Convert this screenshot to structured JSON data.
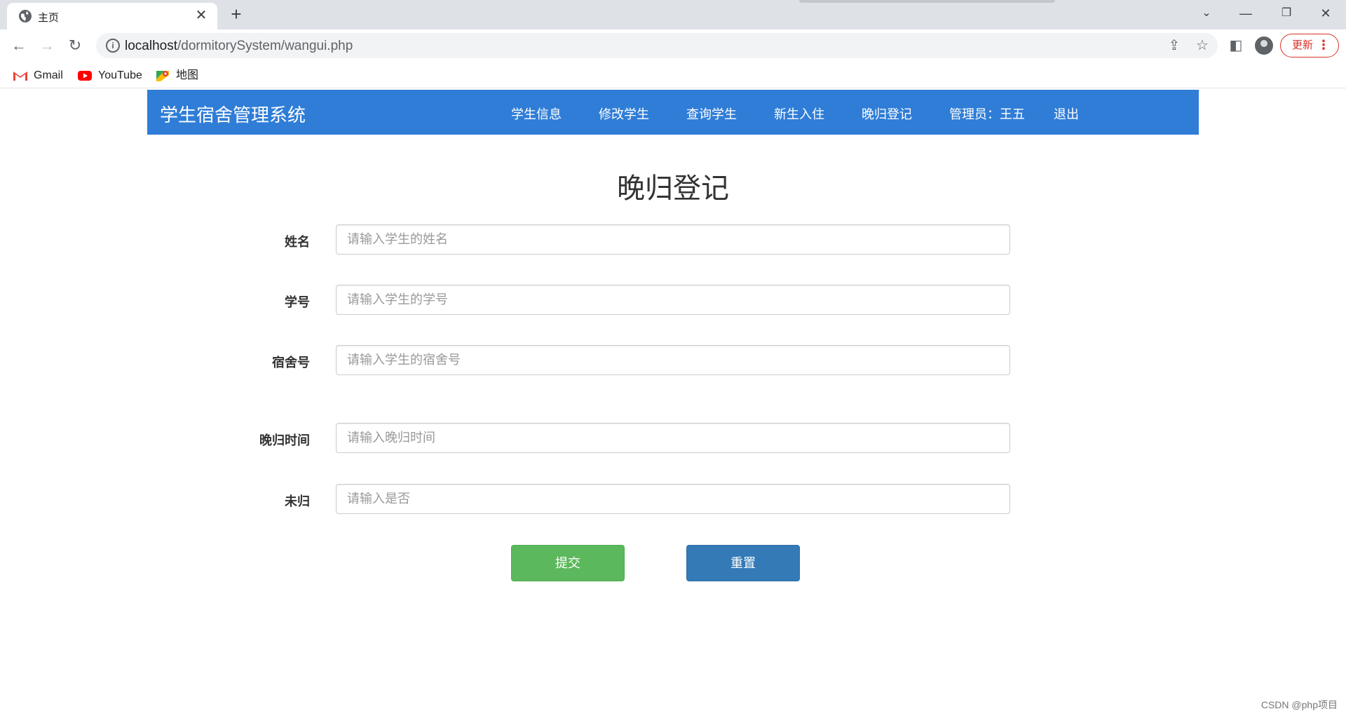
{
  "browser": {
    "tab_title": "主页",
    "url_host": "localhost",
    "url_path": "/dormitorySystem/wangui.php",
    "update_label": "更新",
    "bookmarks": [
      {
        "label": "Gmail",
        "icon": "gmail-icon"
      },
      {
        "label": "YouTube",
        "icon": "youtube-icon"
      },
      {
        "label": "地图",
        "icon": "maps-icon"
      }
    ]
  },
  "navbar": {
    "brand": "学生宿舍管理系统",
    "links": [
      "学生信息",
      "修改学生",
      "查询学生",
      "新生入住",
      "晚归登记",
      "管理员：王五",
      "退出"
    ]
  },
  "page": {
    "title": "晚归登记"
  },
  "form": {
    "fields": [
      {
        "label": "姓名",
        "placeholder": "请输入学生的姓名",
        "value": ""
      },
      {
        "label": "学号",
        "placeholder": "请输入学生的学号",
        "value": ""
      },
      {
        "label": "宿舍号",
        "placeholder": "请输入学生的宿舍号",
        "value": ""
      },
      {
        "label": "晚归时间",
        "placeholder": "请输入晚归时间",
        "value": ""
      },
      {
        "label": "未归",
        "placeholder": "请输入是否",
        "value": ""
      }
    ],
    "submit_label": "提交",
    "reset_label": "重置"
  },
  "watermark": "CSDN @php项目",
  "colors": {
    "navbar": "#2f7dd7",
    "submit": "#5cb85c",
    "reset": "#337ab7",
    "update_accent": "#d93025"
  }
}
